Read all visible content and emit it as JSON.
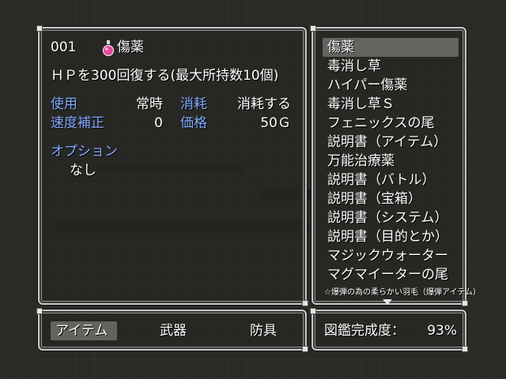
{
  "item_detail": {
    "number": "001",
    "name": "傷薬",
    "icon": "potion-icon",
    "description": "ＨＰを300回復する(最大所持数10個)",
    "use_label": "使用",
    "use_value": "常時",
    "consume_label": "消耗",
    "consume_value": "消耗する",
    "speed_label": "速度補正",
    "speed_value": "0",
    "price_label": "価格",
    "price_value": "50Ｇ",
    "option_label": "オプション",
    "option_value": "なし"
  },
  "item_list": {
    "selected_index": 0,
    "items": [
      "傷薬",
      "毒消し草",
      "ハイパー傷薬",
      "毒消し草Ｓ",
      "フェニックスの尾",
      "説明書（アイテム）",
      "万能治療薬",
      "説明書（バトル）",
      "説明書（宝箱）",
      "説明書（システム）",
      "説明書（目的とか）",
      "マジックウォーター",
      "マグマイーターの尾",
      "☆爆弾の為の柔らかい羽毛（爆弾アイテム）"
    ]
  },
  "categories": {
    "selected": "アイテム",
    "tabs": [
      "アイテム",
      "武器",
      "防具"
    ]
  },
  "completion": {
    "label": "図鑑完成度：",
    "value": "93%"
  },
  "colors": {
    "system_text": "#84aaff",
    "window_border": "#c9c9c9"
  }
}
